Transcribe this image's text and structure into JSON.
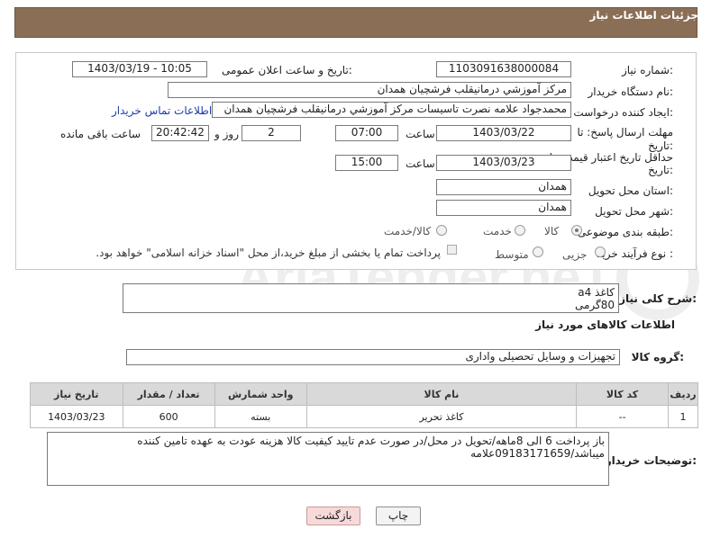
{
  "header": {
    "title": "جزئیات اطلاعات نیاز"
  },
  "form": {
    "need_number": {
      "label": "شماره نیاز:",
      "value": "1103091638000084"
    },
    "announce_datetime": {
      "label": "تاریخ و ساعت اعلان عمومی:",
      "value": "1403/03/19 - 10:05"
    },
    "buyer_org": {
      "label": "نام دستگاه خریدار:",
      "value": "مرکز آموزشي درمانيقلب فرشچيان همدان"
    },
    "requester": {
      "label": "ایجاد کننده درخواست:",
      "value": "محمدجواد علامه نصرت تاسیسات مرکز آموزشي درمانيقلب فرشچيان همدان",
      "contact_link": "اطلاعات تماس خریدار"
    },
    "reply_deadline": {
      "label_line1": "مهلت ارسال پاسخ: تا",
      "label_line2": "تاریخ:",
      "date": "1403/03/22",
      "time_label": "ساعت",
      "time": "07:00",
      "days": "2",
      "days_label": "روز و",
      "remaining": "20:42:42",
      "remaining_label": "ساعت باقی مانده"
    },
    "price_validity": {
      "label_line1": "حداقل تاریخ اعتبار قیمت: تا",
      "label_line2": "تاریخ:",
      "date": "1403/03/23",
      "time_label": "ساعت",
      "time": "15:00"
    },
    "delivery_province": {
      "label": "استان محل تحویل:",
      "value": "همدان"
    },
    "delivery_city": {
      "label": "شهر محل تحویل:",
      "value": "همدان"
    },
    "category": {
      "label": "طبقه بندی موضوعی:",
      "options": [
        "کالا",
        "خدمت",
        "کالا/خدمت"
      ],
      "selected": "کالا"
    },
    "purchase_type": {
      "label": "نوع فرآیند خرید :",
      "options": [
        "جزیی",
        "متوسط"
      ],
      "note": "پرداخت تمام یا بخشی از مبلغ خرید،از محل \"اسناد خزانه اسلامی\" خواهد بود."
    }
  },
  "summary": {
    "label": "شرح کلی نیاز:",
    "line1": "کاغذ a4",
    "line2": "80گرمی"
  },
  "goods_info": {
    "title": "اطلاعات کالاهای مورد نیاز",
    "group_label": "گروه کالا:",
    "group_value": "تجهیزات و وسایل تحصیلی واداری"
  },
  "table": {
    "headers": [
      "ردیف",
      "کد کالا",
      "نام کالا",
      "واحد شمارش",
      "تعداد / مقدار",
      "تاریخ نیاز"
    ],
    "rows": [
      [
        "1",
        "--",
        "کاغذ تحریر",
        "بسته",
        "600",
        "1403/03/23"
      ]
    ]
  },
  "buyer_notes": {
    "label": "توضیحات خریدار:",
    "text": "باز پرداخت 6 الی 8ماهه/تحویل در محل/در صورت عدم تایید کیفیت کالا هزینه عودت به عهده تامین کننده میباشد/09183171659علامه"
  },
  "buttons": {
    "print": "چاپ",
    "back": "بازگشت"
  },
  "watermark": {
    "text": "AriaTender.neT"
  },
  "colors": {
    "header_bg": "#8a6f56",
    "link": "#1a3ea8",
    "table_header_bg": "#d9d9d9"
  }
}
